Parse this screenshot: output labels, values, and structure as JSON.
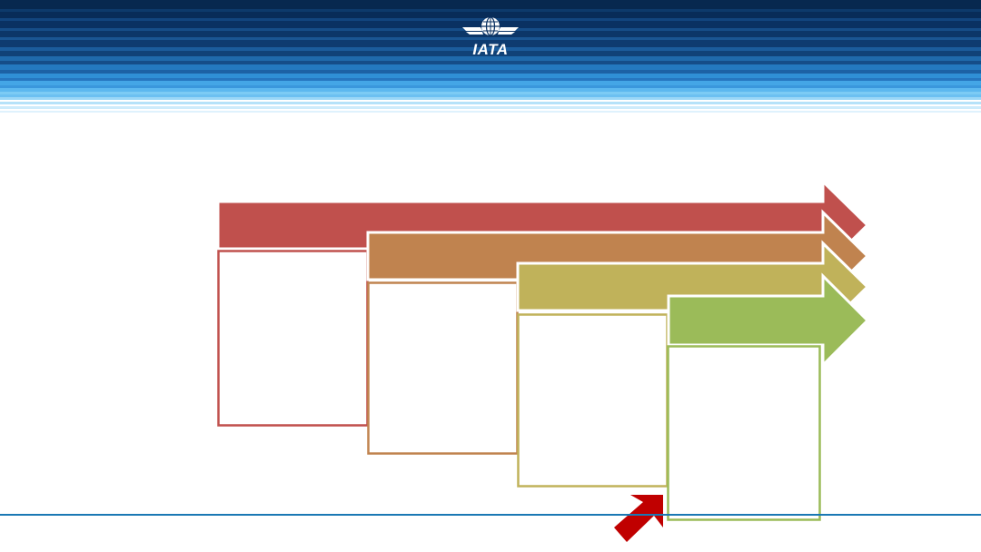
{
  "header": {
    "logo_text": "IATA",
    "colors": {
      "navy": "#0a2f5e",
      "mid_blue": "#1f6fb3",
      "light_blue": "#6cc5f0"
    }
  },
  "diagram": {
    "stages": [
      {
        "name": "stage-1",
        "color": "#c0504d",
        "label": ""
      },
      {
        "name": "stage-2",
        "color": "#c0834f",
        "label": ""
      },
      {
        "name": "stage-3",
        "color": "#c0b25a",
        "label": ""
      },
      {
        "name": "stage-4",
        "color": "#9bbb59",
        "label": ""
      }
    ],
    "pointer": {
      "color": "#c00000",
      "icon": "diagonal-arrow-icon"
    }
  },
  "footer": {
    "line_color": "#1a78b4"
  }
}
